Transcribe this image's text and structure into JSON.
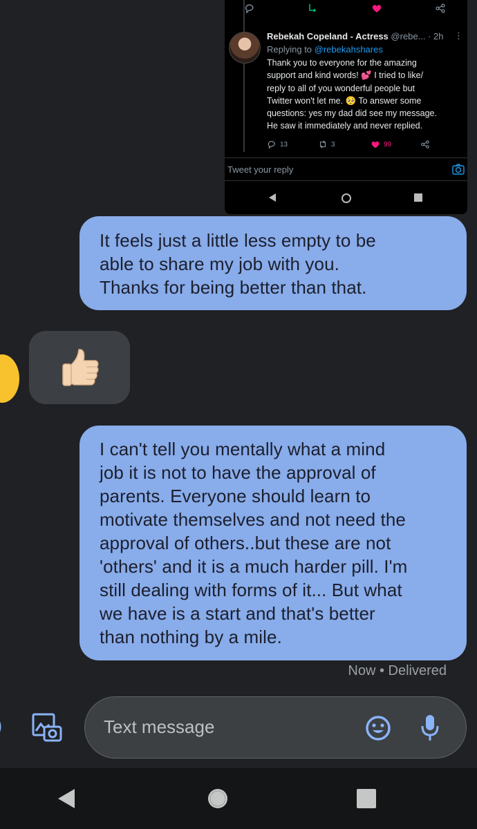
{
  "tweet": {
    "author_name": "Rebekah Copeland - Actress",
    "handle_time": "@rebe... · 2h",
    "replying_prefix": "Replying to ",
    "replying_to": "@rebekahshares",
    "text_lines": [
      "Thank you to everyone for the amazing",
      "support and kind words! 💕 I tried to like/",
      "reply to all of you wonderful people but",
      "Twitter won't let me. 🥺 To answer some",
      "questions: yes my dad did see my message.",
      "He saw it immediately and never replied."
    ],
    "reply_count": "13",
    "retweet_count": "3",
    "like_count": "99",
    "reply_placeholder": "Tweet your reply",
    "colors": {
      "link": "#1d9bf0",
      "like": "#f91880",
      "retweet": "#00ba7c",
      "background": "#000000"
    }
  },
  "messages": {
    "outgoing_1_lines": [
      "It feels just a little less empty to be",
      "able to share my job with you.",
      "Thanks for being better than that."
    ],
    "reaction_icon": "thumbs-up-icon",
    "outgoing_2_lines": [
      "I can't tell you mentally what a mind",
      "job it is not to have the approval of",
      "parents. Everyone should learn to",
      "motivate themselves and not need the",
      "approval of others..but these are not",
      "'others' and it is a much harder pill. I'm",
      "still dealing with forms of it... But what",
      "we have is a start and that's better",
      "than nothing by a mile."
    ],
    "status": "Now • Delivered",
    "colors": {
      "outgoing_bubble": "#89acea",
      "reaction_bubble": "#3c3f43",
      "contact_avatar": "#f7c22e"
    }
  },
  "composer": {
    "placeholder": "Text message",
    "icons": [
      "add-icon",
      "gallery-icon",
      "emoji-icon",
      "mic-icon"
    ],
    "accent": "#8ab4f8"
  },
  "nav": {
    "icons": [
      "back-icon",
      "home-icon",
      "recents-icon"
    ]
  }
}
